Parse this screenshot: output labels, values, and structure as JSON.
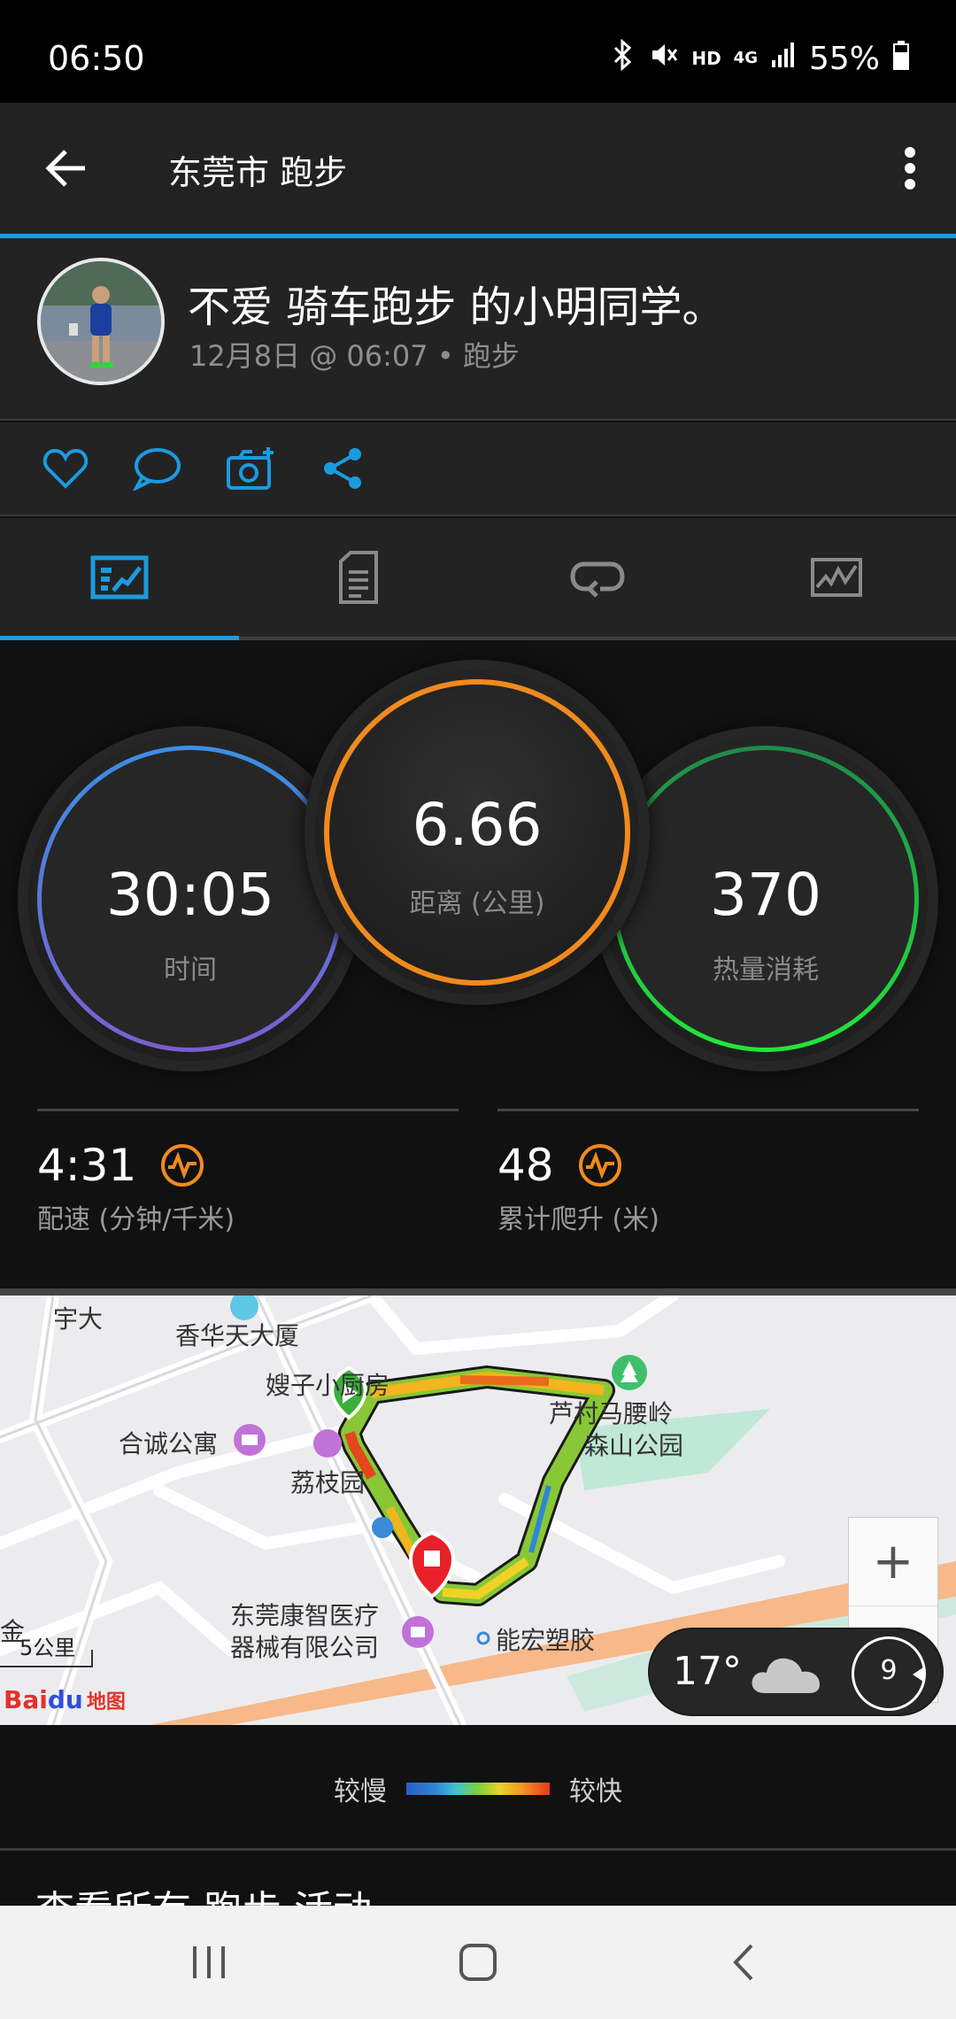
{
  "status_bar": {
    "time": "06:50",
    "hd": "HD",
    "network": "4G",
    "battery": "55%"
  },
  "app_bar": {
    "title": "东莞市 跑步"
  },
  "activity": {
    "user_name": "不爱 骑车跑步 的小明同学。",
    "meta": "12月8日 @ 06:07 • 跑步"
  },
  "tabs": [
    {
      "icon": "summary-chart-icon",
      "active": true
    },
    {
      "icon": "details-document-icon",
      "active": false
    },
    {
      "icon": "laps-loop-icon",
      "active": false
    },
    {
      "icon": "graphs-icon",
      "active": false
    }
  ],
  "gauges": {
    "time": {
      "value": "30:05",
      "label": "时间",
      "color": "#4a8fe0"
    },
    "distance": {
      "value": "6.66",
      "label": "距离 (公里)",
      "color": "#f08a1e"
    },
    "calories": {
      "value": "370",
      "label": "热量消耗",
      "color": "#22d63a"
    }
  },
  "metrics": {
    "pace": {
      "value": "4:31",
      "label": "配速 (分钟/千米)"
    },
    "ascent": {
      "value": "48",
      "label": "累计爬升 (米)"
    }
  },
  "map": {
    "labels": {
      "yuda": "宇大",
      "xianghua": "香华天大厦",
      "saozi": "嫂子小厨房",
      "hecheng": "合诚公寓",
      "lizhi": "荔枝园",
      "lucun": "芦村马腰岭",
      "park": "森山公园",
      "kangzhi_1": "东莞康智医疗",
      "kangzhi_2": "器械有限公司",
      "nenghong": "能宏塑胶",
      "jin": "金",
      "scale": "5公里",
      "baidu": "Bai",
      "baidu_du": "du",
      "baidu_map": "地图"
    },
    "zoom_in": "+",
    "weather": {
      "temp": "17°",
      "wind": "9"
    }
  },
  "legend": {
    "slow": "较慢",
    "fast": "较快"
  },
  "footer_text": "查看所有 跑步 活动"
}
